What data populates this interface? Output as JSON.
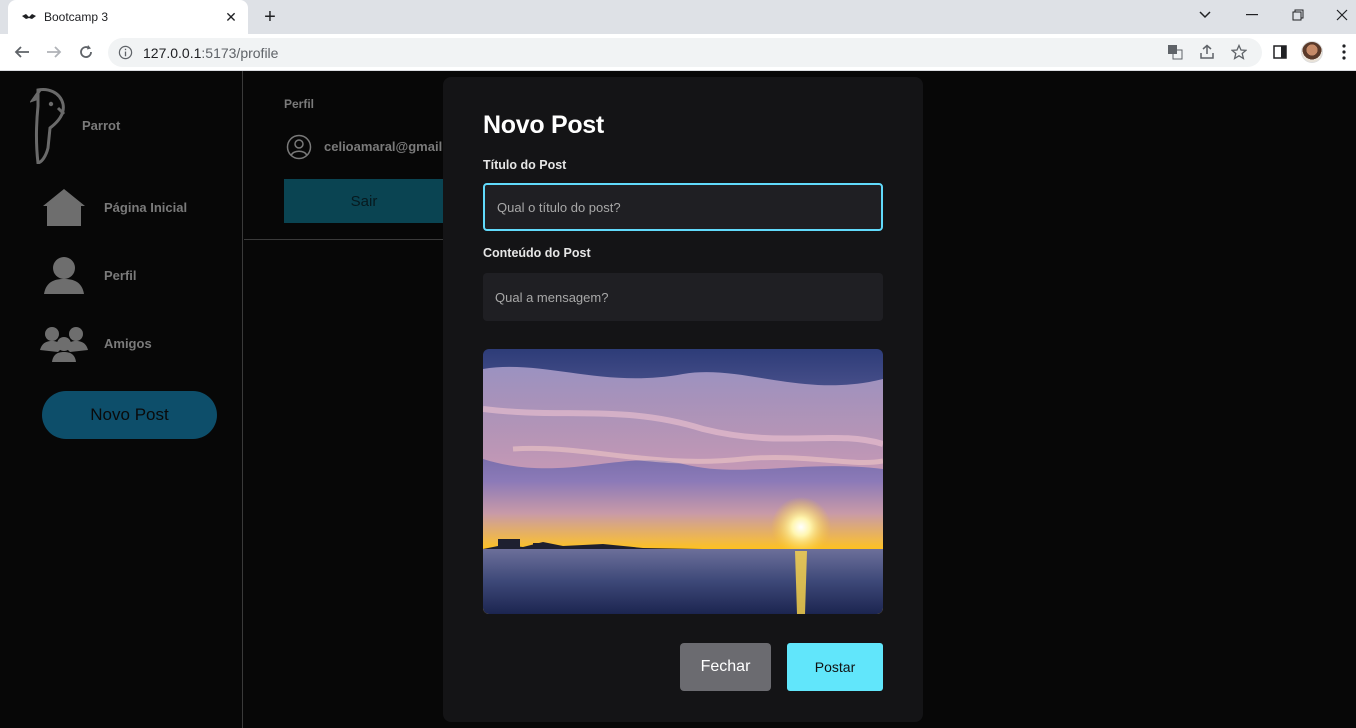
{
  "browser": {
    "tab_title": "Bootcamp 3",
    "url_host": "127.0.0.1",
    "url_path": ":5173/profile"
  },
  "sidebar": {
    "brand": "Parrot",
    "items": [
      {
        "label": "Página Inicial",
        "icon": "home-icon"
      },
      {
        "label": "Perfil",
        "icon": "user-icon"
      },
      {
        "label": "Amigos",
        "icon": "friends-icon"
      }
    ],
    "novo_post_label": "Novo Post"
  },
  "profile": {
    "title": "Perfil",
    "email": "celioamaral@gmail.",
    "sair_label": "Sair"
  },
  "modal": {
    "title": "Novo Post",
    "title_label": "Título do Post",
    "title_placeholder": "Qual o título do post?",
    "content_label": "Conteúdo do Post",
    "content_placeholder": "Qual a mensagem?",
    "fechar_label": "Fechar",
    "postar_label": "Postar"
  },
  "colors": {
    "accent": "#61dafb",
    "sidebar_button": "#0d4e6a",
    "modal_bg": "#141416"
  }
}
